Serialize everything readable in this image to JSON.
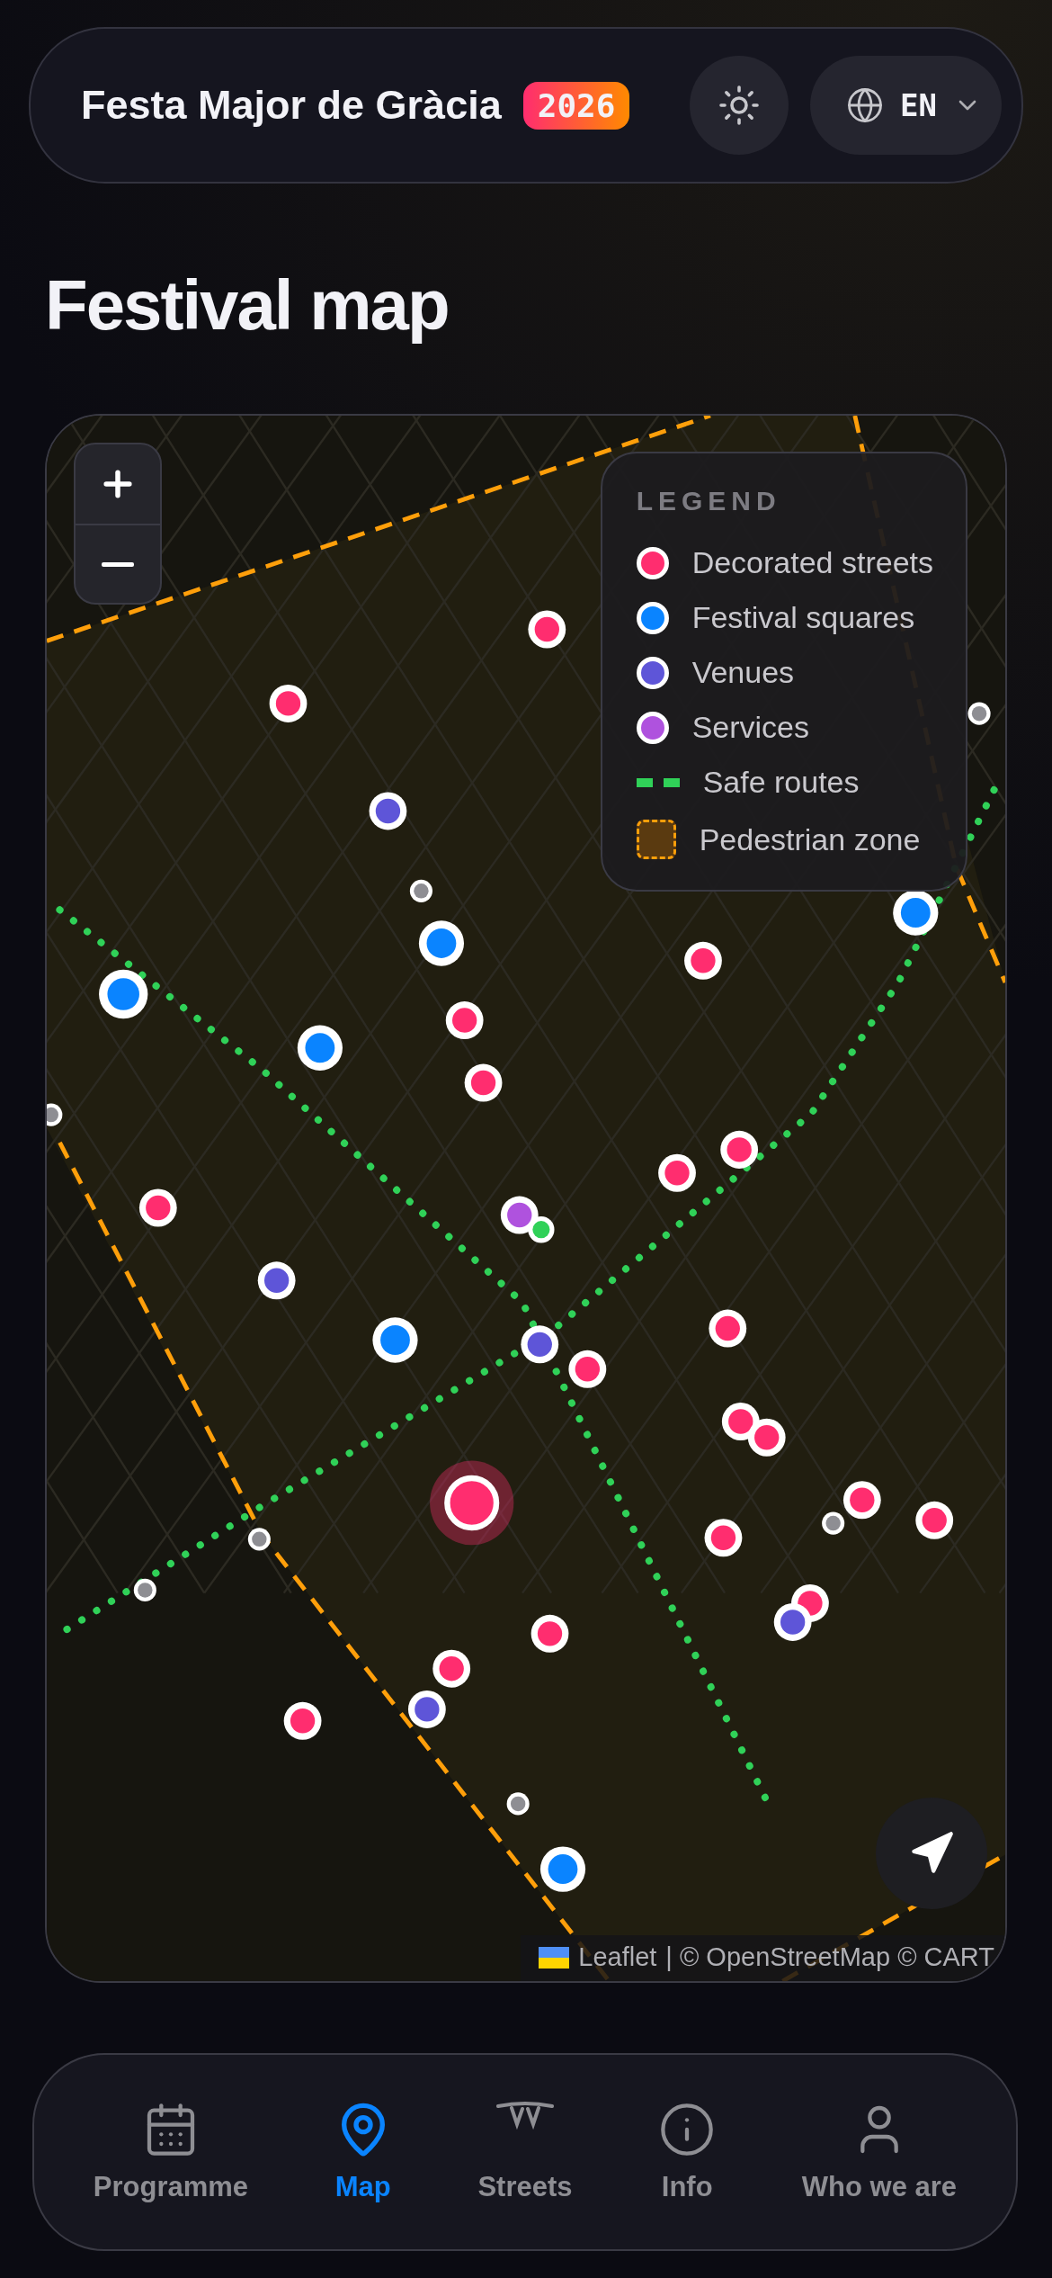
{
  "header": {
    "title": "Festa Major de Gràcia",
    "year_badge": "2026",
    "language": "EN"
  },
  "page_title": "Festival map",
  "map": {
    "legend": {
      "title": "LEGEND",
      "items": [
        {
          "kind": "dot",
          "label": "Decorated streets",
          "color": "#ff2d6f"
        },
        {
          "kind": "dot",
          "label": "Festival squares",
          "color": "#0a84ff"
        },
        {
          "kind": "dot",
          "label": "Venues",
          "color": "#5e55d8"
        },
        {
          "kind": "dot",
          "label": "Services",
          "color": "#af52de"
        },
        {
          "kind": "line",
          "label": "Safe routes",
          "color": "#30d158"
        },
        {
          "kind": "zone",
          "label": "Pedestrian zone",
          "color": "#ff9f0a"
        }
      ]
    },
    "attribution": {
      "leaflet": "Leaflet",
      "rest": "| © OpenStreetMap © CART"
    }
  },
  "nav": [
    {
      "label": "Programme",
      "selected": false
    },
    {
      "label": "Map",
      "selected": true
    },
    {
      "label": "Streets",
      "selected": false
    },
    {
      "label": "Info",
      "selected": false
    },
    {
      "label": "Who we are",
      "selected": false
    }
  ]
}
